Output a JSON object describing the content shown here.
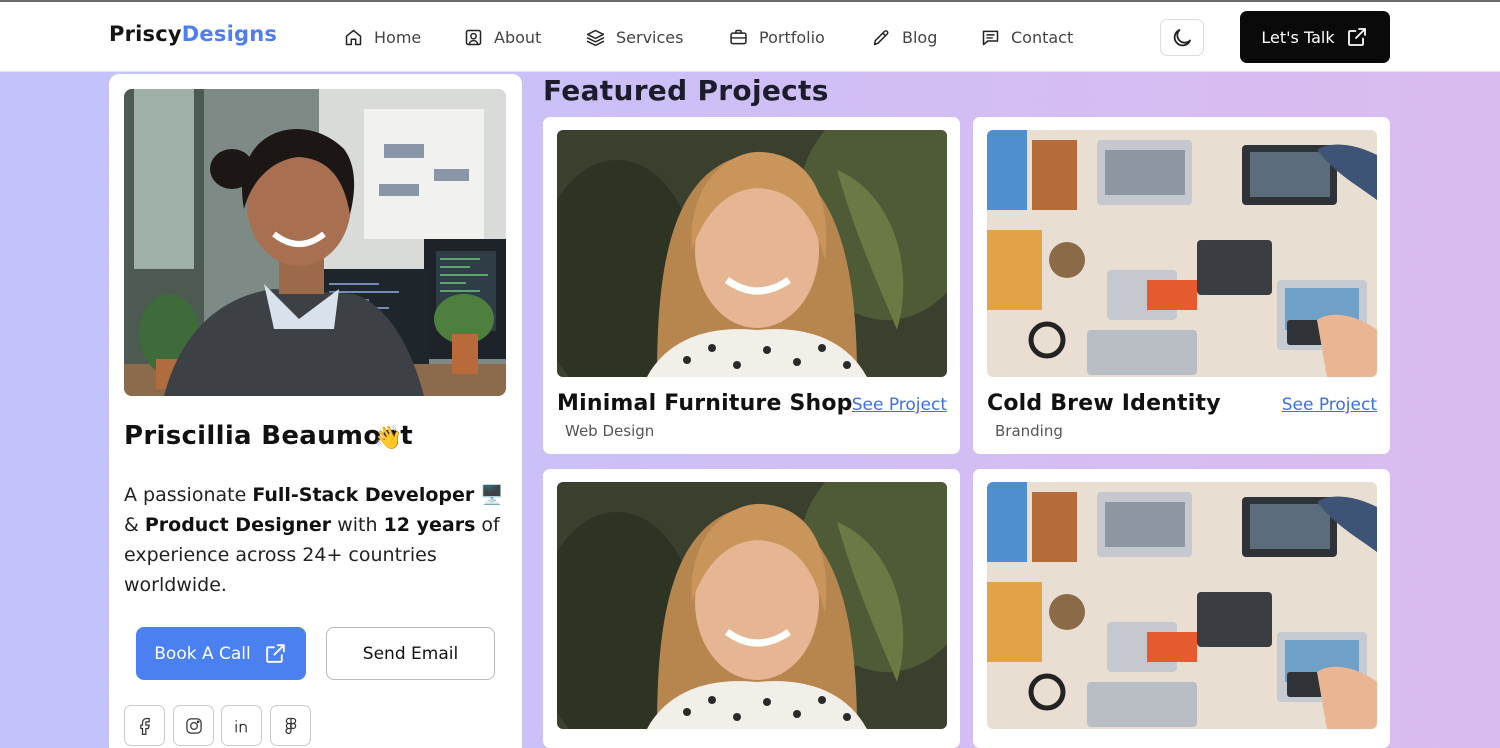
{
  "brand": {
    "part1": "Priscy",
    "part2": "Designs",
    "accent": "#4d7ef2"
  },
  "nav": {
    "items": [
      {
        "label": "Home",
        "icon": "home-icon"
      },
      {
        "label": "About",
        "icon": "user-square-icon"
      },
      {
        "label": "Services",
        "icon": "layers-icon"
      },
      {
        "label": "Portfolio",
        "icon": "briefcase-icon"
      },
      {
        "label": "Blog",
        "icon": "pen-icon"
      },
      {
        "label": "Contact",
        "icon": "message-icon"
      }
    ],
    "theme_toggle_icon": "moon-icon",
    "cta_label": "Let's Talk",
    "cta_icon": "external-link-icon"
  },
  "profile": {
    "name": "Priscillia Beaumont",
    "wave": "👋",
    "bio": {
      "t1": "A passionate ",
      "b1": "Full-Stack Developer",
      "emoji": "🖥️",
      "t2": " & ",
      "b2": "Product Designer",
      "t3": " with ",
      "b3": "12 years",
      "t4": " of experience across 24+ countries worldwide."
    },
    "book_label": "Book A Call",
    "email_label": "Send Email",
    "socials": [
      "facebook-icon",
      "instagram-icon",
      "linkedin-icon",
      "figma-icon"
    ]
  },
  "projects": {
    "title": "Featured Projects",
    "items": [
      {
        "title": "Minimal Furniture Shop",
        "category": "Web Design",
        "link": "See Project"
      },
      {
        "title": "Cold Brew Identity",
        "category": "Branding",
        "link": "See Project"
      },
      {
        "title": "",
        "category": "",
        "link": ""
      },
      {
        "title": "",
        "category": "",
        "link": ""
      }
    ]
  }
}
